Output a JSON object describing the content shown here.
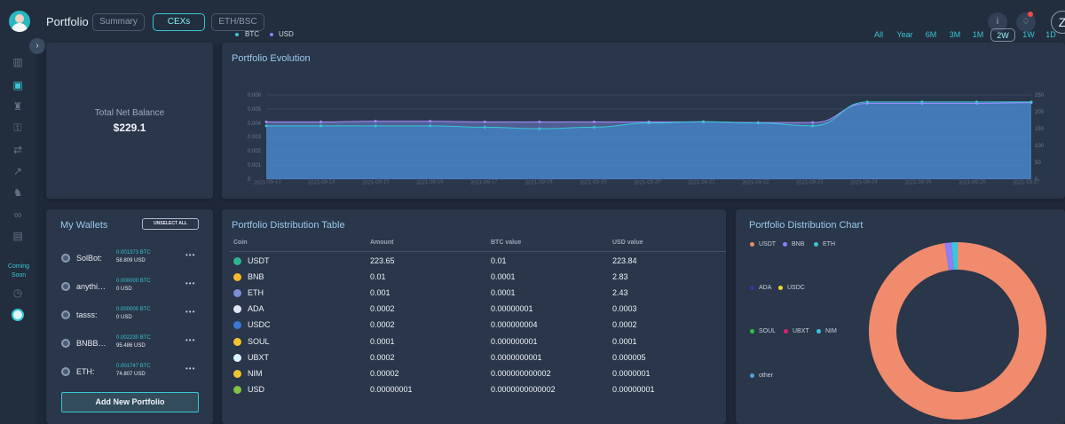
{
  "header": {
    "title": "Portfolio",
    "tabs": [
      "Summary",
      "CEXs",
      "ETH/BSC"
    ],
    "active_tab": "CEXs",
    "info_icon": "info-icon",
    "notifications_icon": "bell-icon",
    "user_initial": "Z"
  },
  "sidebar": {
    "icons": [
      "bar-chart-icon",
      "briefcase-icon",
      "piggy-bank-icon",
      "key-icon",
      "swap-icon",
      "trending-up-icon",
      "dog-icon",
      "infinity-icon",
      "wallet-icon",
      "clock-icon",
      "round-logo-icon"
    ],
    "active_icon": "briefcase-icon",
    "coming_soon": "Coming Soon"
  },
  "net_balance": {
    "label": "Total Net Balance",
    "value": "$229.1"
  },
  "evolution": {
    "title": "Portfolio Evolution",
    "legend": [
      "BTC",
      "USD"
    ],
    "ranges": [
      "All",
      "Year",
      "6M",
      "3M",
      "1M",
      "2W",
      "1W",
      "1D"
    ],
    "active_range": "2W",
    "left_axis": [
      "0.006",
      "0.005",
      "0.004",
      "0.003",
      "0.002",
      "0.001",
      "0"
    ],
    "right_axis": [
      "250",
      "200",
      "150",
      "100",
      "50",
      "0"
    ],
    "dates": [
      "2021-09-13",
      "2021-09-14",
      "2021-09-15",
      "2021-09-16",
      "2021-09-17",
      "2021-09-18",
      "2021-09-19",
      "2021-09-20",
      "2021-09-21",
      "2021-09-22",
      "2021-09-23",
      "2021-09-24",
      "2021-09-25",
      "2021-09-26",
      "2021-09-27"
    ]
  },
  "chart_data": {
    "type": "area",
    "x": [
      "2021-09-13",
      "2021-09-14",
      "2021-09-15",
      "2021-09-16",
      "2021-09-17",
      "2021-09-18",
      "2021-09-19",
      "2021-09-20",
      "2021-09-21",
      "2021-09-22",
      "2021-09-23",
      "2021-09-24",
      "2021-09-25",
      "2021-09-26",
      "2021-09-27"
    ],
    "series": [
      {
        "name": "BTC",
        "axis": "left",
        "values": [
          0.0038,
          0.0038,
          0.0038,
          0.0038,
          0.0037,
          0.0036,
          0.0037,
          0.004,
          0.0041,
          0.004,
          0.0038,
          0.0055,
          0.0055,
          0.0055,
          0.0055
        ]
      },
      {
        "name": "USD",
        "axis": "right",
        "values": [
          170,
          170,
          172,
          172,
          170,
          170,
          170,
          170,
          170,
          168,
          168,
          225,
          225,
          225,
          227
        ]
      }
    ],
    "ylim_left": [
      0,
      0.006
    ],
    "ylim_right": [
      0,
      250
    ],
    "grid": true,
    "legend_position": "top-left",
    "colors": {
      "BTC": "#37c7d7",
      "USD": "#8e7dff"
    }
  },
  "wallets": {
    "title": "My Wallets",
    "unselect_label": "UNSELECT ALL",
    "items": [
      {
        "name": "SolBot:",
        "btc": "0.001373 BTC",
        "usd": "58.809 USD"
      },
      {
        "name": "anythi…",
        "btc": "0.000000 BTC",
        "usd": "0 USD"
      },
      {
        "name": "tasss:",
        "btc": "0.000000 BTC",
        "usd": "0 USD"
      },
      {
        "name": "BNBB…",
        "btc": "0.002230 BTC",
        "usd": "95.486 USD"
      },
      {
        "name": "ETH:",
        "btc": "0.001747 BTC",
        "usd": "74.807 USD"
      }
    ],
    "menu": "•••",
    "add_label": "Add New Portfolio"
  },
  "distribution_table": {
    "title": "Portfolio Distribution Table",
    "headers": [
      "Coin",
      "Amount",
      "BTC value",
      "USD value"
    ],
    "rows": [
      {
        "coin": "USDT",
        "amount": "223.65",
        "btc": "0.01",
        "usd": "223.84"
      },
      {
        "coin": "BNB",
        "amount": "0.01",
        "btc": "0.0001",
        "usd": "2.83"
      },
      {
        "coin": "ETH",
        "amount": "0.001",
        "btc": "0.0001",
        "usd": "2.43"
      },
      {
        "coin": "ADA",
        "amount": "0.0002",
        "btc": "0.00000001",
        "usd": "0.0003"
      },
      {
        "coin": "USDC",
        "amount": "0.0002",
        "btc": "0.000000004",
        "usd": "0.0002"
      },
      {
        "coin": "SOUL",
        "amount": "0.0001",
        "btc": "0.000000001",
        "usd": "0.0001"
      },
      {
        "coin": "UBXT",
        "amount": "0.0002",
        "btc": "0.0000000001",
        "usd": "0.000005"
      },
      {
        "coin": "NIM",
        "amount": "0.00002",
        "btc": "0.000000000002",
        "usd": "0.0000001"
      },
      {
        "coin": "USD",
        "amount": "0.00000001",
        "btc": "0.0000000000002",
        "usd": "0.00000001"
      }
    ]
  },
  "distribution_chart": {
    "title": "Portfolio Distribution Chart",
    "legend": [
      "USDT",
      "BNB",
      "ETH",
      "ADA",
      "USDC",
      "SOUL",
      "UBXT",
      "NIM",
      "other"
    ],
    "colors": [
      "#f08b6d",
      "#8e7dff",
      "#37c7d7",
      "#2b3aa8",
      "#f2d23b",
      "#22c947",
      "#e0207a",
      "#35c4df",
      "#4fa0d8"
    ],
    "slice_values": [
      223.84,
      2.83,
      2.43,
      0.0003,
      0.0002,
      0.0001,
      5e-06,
      1e-07,
      1e-08
    ]
  }
}
